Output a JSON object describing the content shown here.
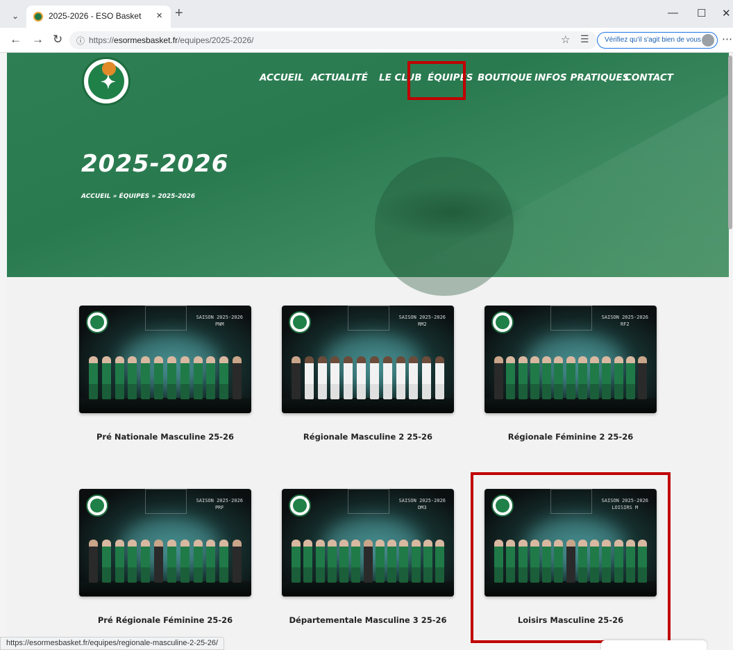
{
  "browser": {
    "tab_title": "2025-2026 - ESO Basket",
    "url_prefix": "https://",
    "url_domain": "esormesbasket.fr",
    "url_path": "/equipes/2025-2026/",
    "verify_label": "Vérifiez qu'il s'agit bien de vous",
    "status_url": "https://esormesbasket.fr/equipes/regionale-masculine-2-25-26/"
  },
  "site": {
    "nav": [
      "ACCUEIL",
      "ACTUALITÉ",
      "LE CLUB",
      "ÉQUIPES",
      "BOUTIQUE",
      "INFOS PRATIQUES",
      "CONTACT"
    ],
    "page_title": "2025-2026",
    "breadcrumb": "ACCUEIL » ÉQUIPES » 2025-2026"
  },
  "teams": [
    {
      "title": "Pré Nationale Masculine 25-26",
      "season_line1": "SAISON 2025-2026",
      "season_line2": "PNM",
      "kit": "green"
    },
    {
      "title": "Régionale Masculine 2 25-26",
      "season_line1": "SAISON 2025-2026",
      "season_line2": "RM2",
      "kit": "white"
    },
    {
      "title": "Régionale Féminine 2 25-26",
      "season_line1": "SAISON 2025-2026",
      "season_line2": "RF2",
      "kit": "green"
    },
    {
      "title": "Pré Régionale Féminine 25-26",
      "season_line1": "SAISON 2025-2026",
      "season_line2": "PRF",
      "kit": "green"
    },
    {
      "title": "Départementale Masculine 3 25-26",
      "season_line1": "SAISON 2025-2026",
      "season_line2": "DM3",
      "kit": "green"
    },
    {
      "title": "Loisirs Masculine 25-26",
      "season_line1": "SAISON 2025-2026",
      "season_line2": "LOISIRS M",
      "kit": "green"
    }
  ],
  "colors": {
    "brand_green": "#2f7f55",
    "highlight": "#c00000"
  },
  "icons": [
    "tab-list-icon",
    "close-icon",
    "plus-icon",
    "minimize-icon",
    "maximize-icon",
    "back-icon",
    "forward-icon",
    "reload-icon",
    "site-info-icon",
    "star-icon",
    "favorites-icon",
    "more-icon"
  ]
}
